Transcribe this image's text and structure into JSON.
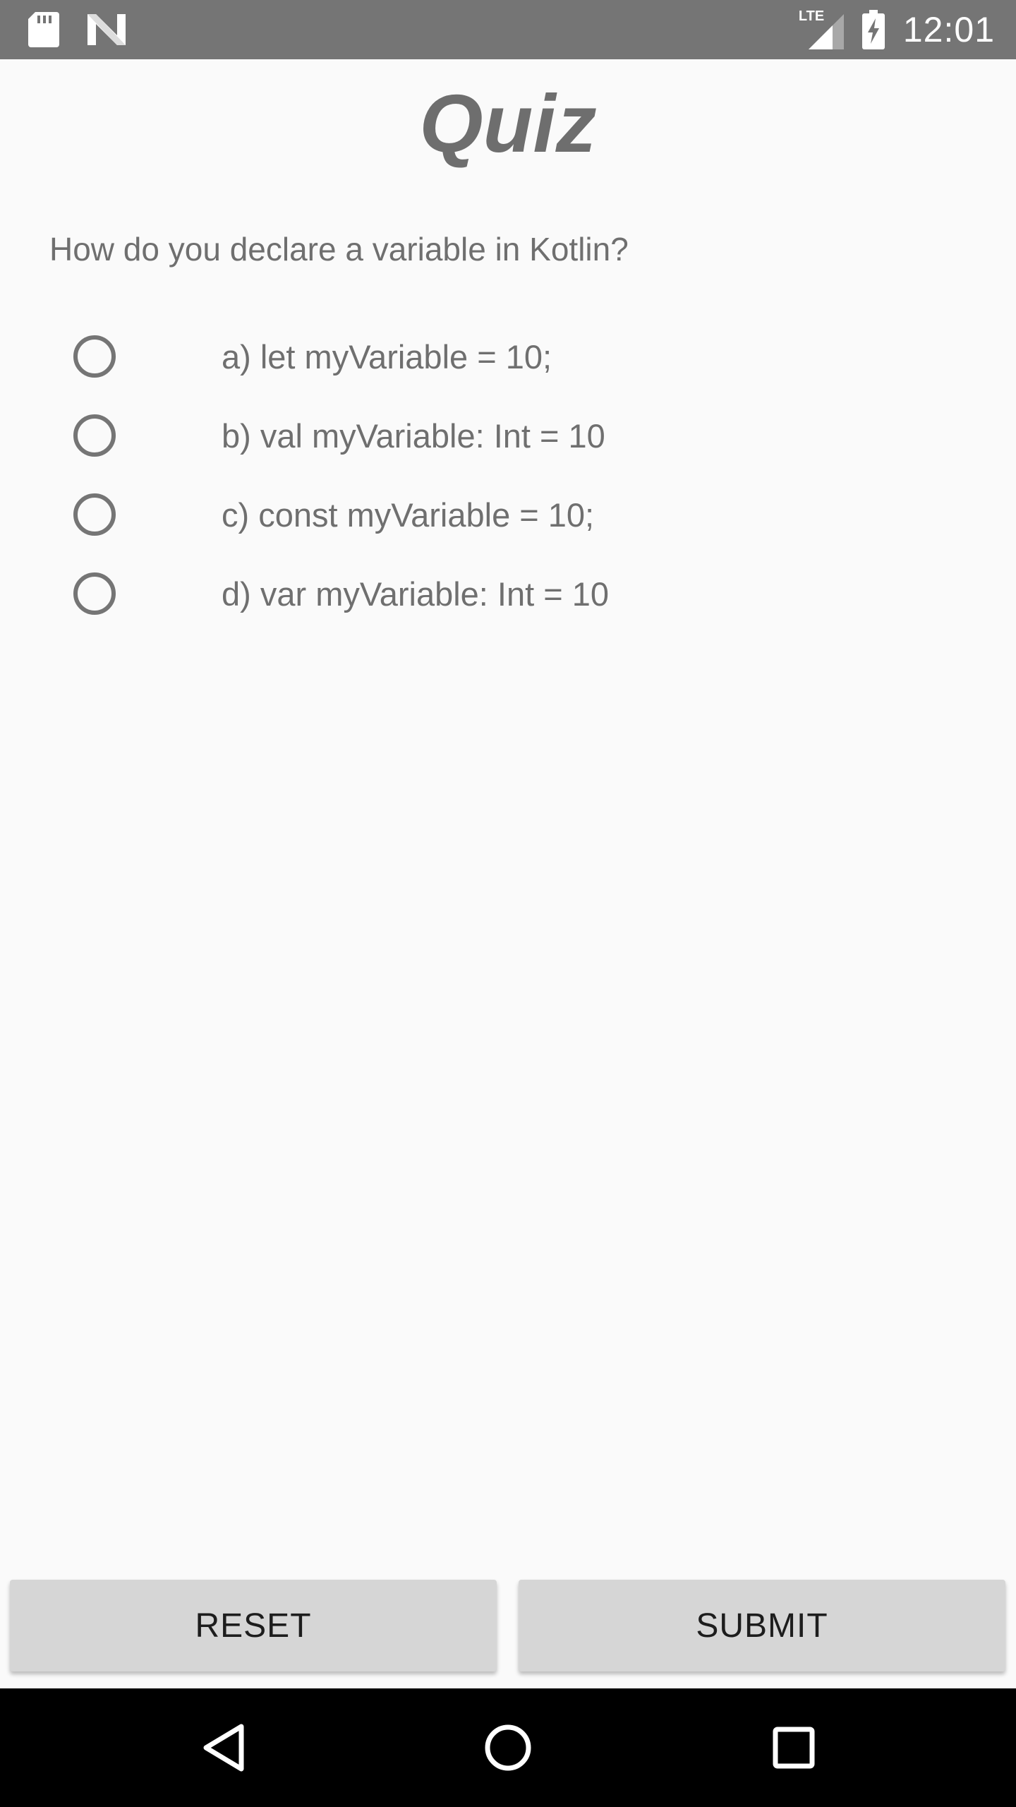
{
  "status_bar": {
    "time": "12:01",
    "network": "LTE",
    "icons": [
      "sd-card-icon",
      "n-logo-icon",
      "signal-icon",
      "battery-charging-icon"
    ]
  },
  "quiz": {
    "title": "Quiz",
    "question": "How do you declare a variable in Kotlin?",
    "options": [
      {
        "label": "a) let myVariable = 10;",
        "selected": false
      },
      {
        "label": "b) val myVariable: Int = 10",
        "selected": false
      },
      {
        "label": "c) const myVariable = 10;",
        "selected": false
      },
      {
        "label": "d) var myVariable: Int = 10",
        "selected": false
      }
    ]
  },
  "buttons": {
    "reset_label": "RESET",
    "submit_label": "SUBMIT"
  },
  "nav_bar": {
    "icons": [
      "back-icon",
      "home-icon",
      "recents-icon"
    ]
  },
  "colors": {
    "status_bar": "#757575",
    "background": "#fafafa",
    "text": "#6f6f6f",
    "button": "#d6d6d6",
    "nav_bar": "#000000"
  }
}
